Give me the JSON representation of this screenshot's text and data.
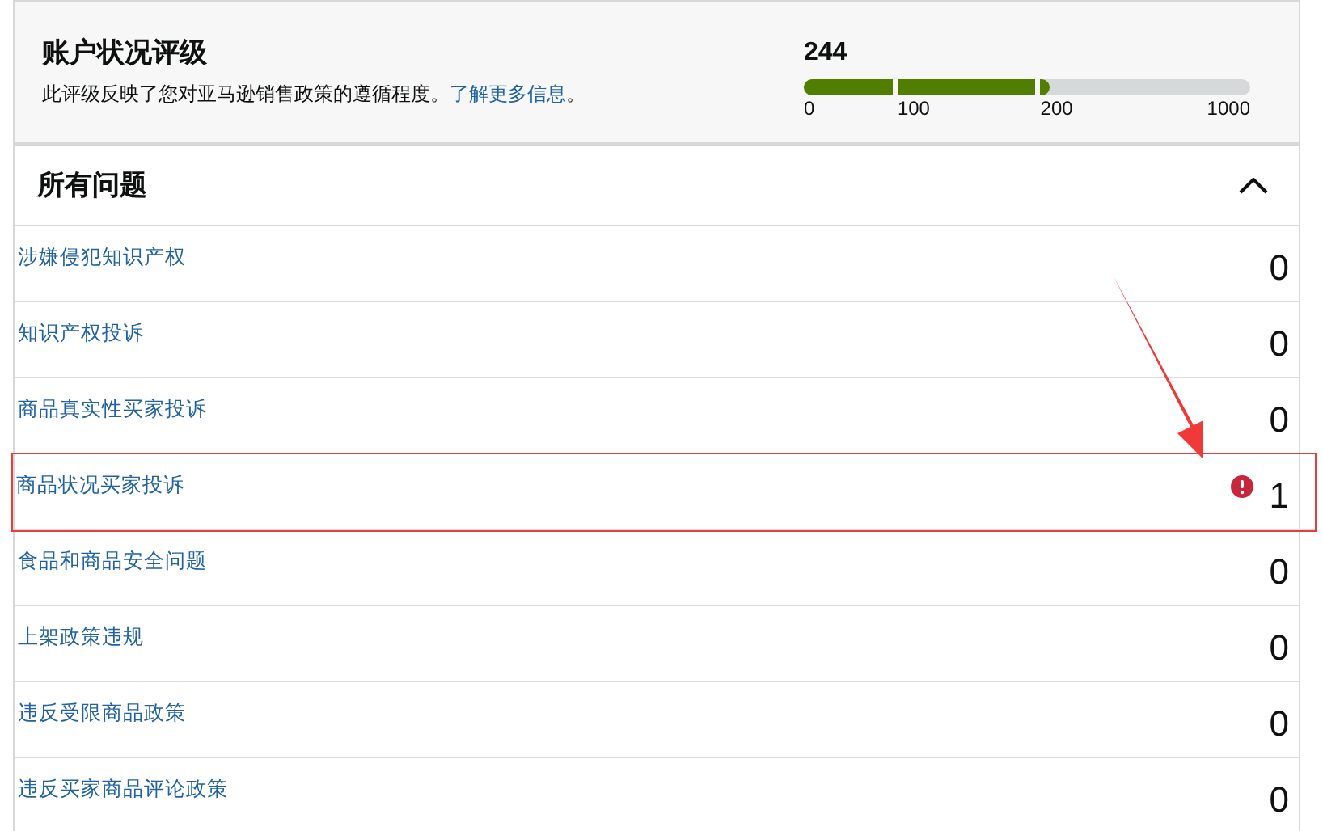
{
  "header": {
    "title": "账户状况评级",
    "description": "此评级反映了您对亚马逊销售政策的遵循程度。",
    "link": "了解更多信息",
    "suffix": "。",
    "score": "244",
    "level": 0.55,
    "ticks": [
      "0",
      "100",
      "200",
      "1000"
    ]
  },
  "section": {
    "title": "所有问题",
    "expanded": true
  },
  "issues": [
    {
      "label": "涉嫌侵犯知识产权",
      "count": "0",
      "alert": false,
      "highlighted": false
    },
    {
      "label": "知识产权投诉",
      "count": "0",
      "alert": false,
      "highlighted": false
    },
    {
      "label": "商品真实性买家投诉",
      "count": "0",
      "alert": false,
      "highlighted": false
    },
    {
      "label": "商品状况买家投诉",
      "count": "1",
      "alert": true,
      "highlighted": true
    },
    {
      "label": "食品和商品安全问题",
      "count": "0",
      "alert": false,
      "highlighted": false
    },
    {
      "label": "上架政策违规",
      "count": "0",
      "alert": false,
      "highlighted": false
    },
    {
      "label": "违反受限商品政策",
      "count": "0",
      "alert": false,
      "highlighted": false
    },
    {
      "label": "违反买家商品评论政策",
      "count": "0",
      "alert": false,
      "highlighted": false
    }
  ]
}
